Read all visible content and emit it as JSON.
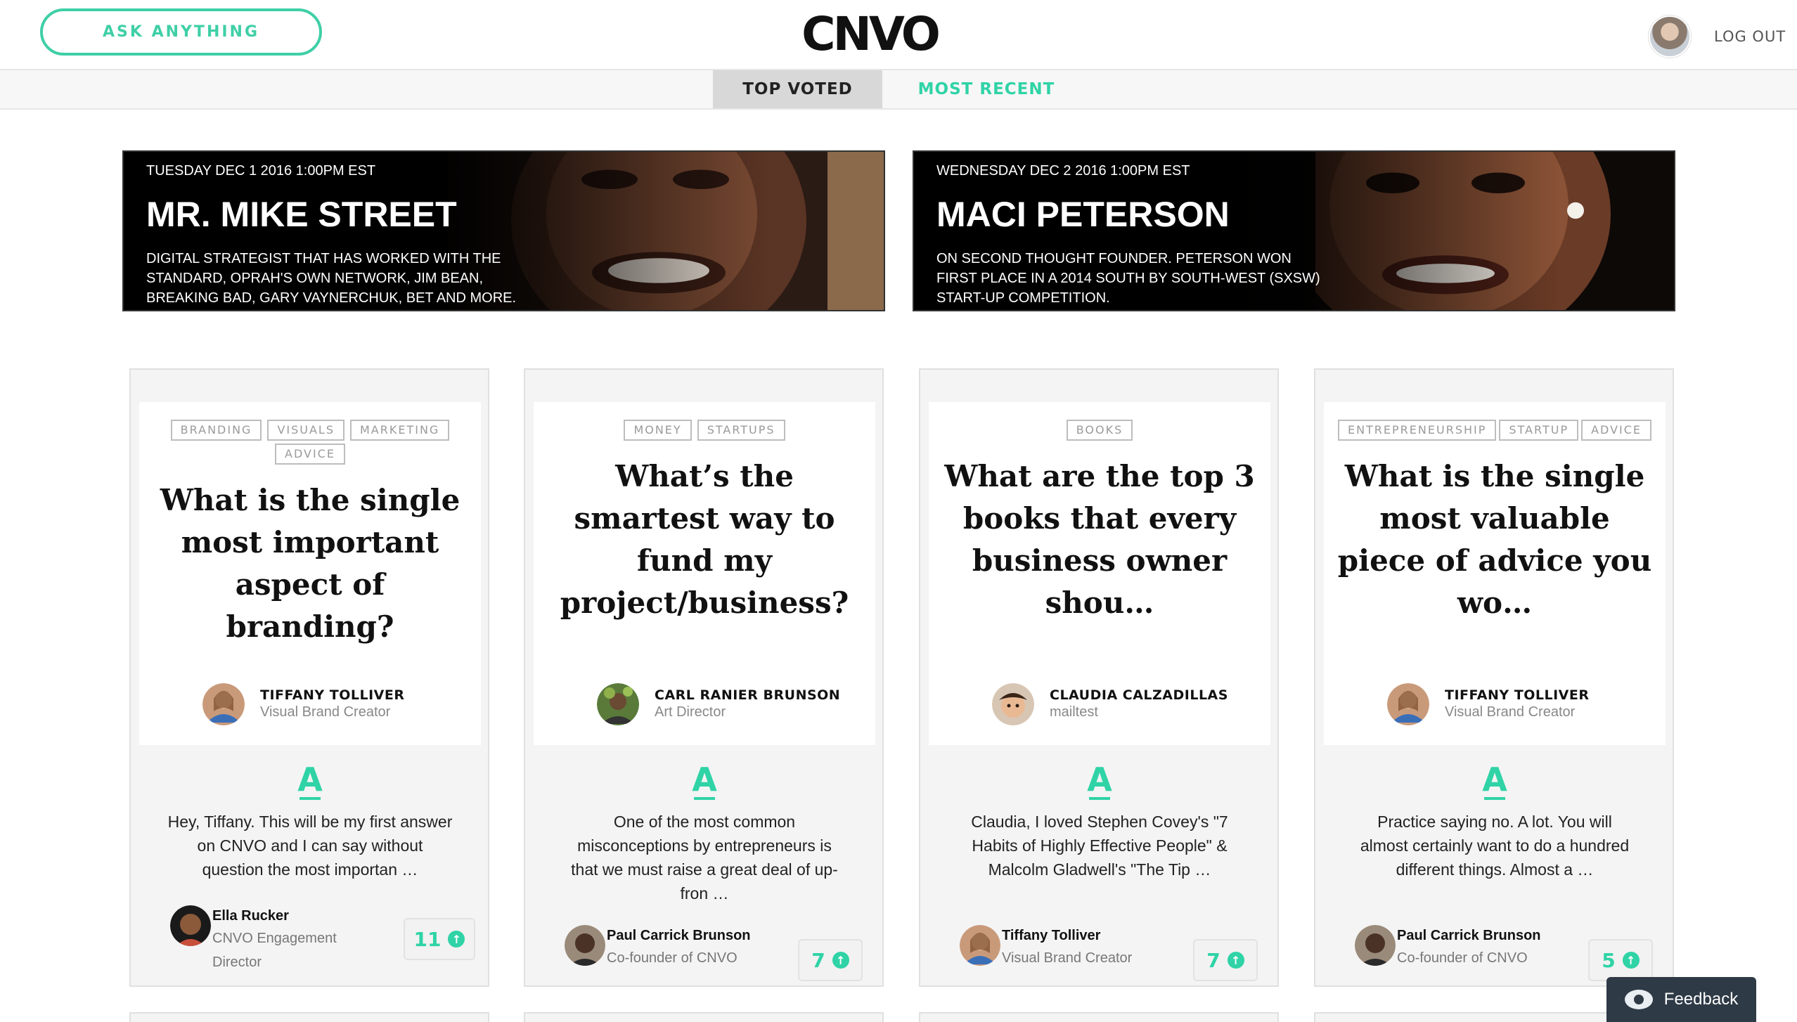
{
  "header": {
    "ask_label": "ASK ANYTHING",
    "logo_text": "CNVO",
    "logout_label": "LOG OUT"
  },
  "tabs": [
    {
      "label": "TOP VOTED",
      "active": true
    },
    {
      "label": "MOST RECENT",
      "active": false
    }
  ],
  "banners": [
    {
      "date": "TUESDAY DEC 1 2016 1:00PM EST",
      "name": "MR. MIKE STREET",
      "description": "DIGITAL STRATEGIST THAT HAS WORKED WITH THE STANDARD, OPRAH'S OWN NETWORK, JIM BEAN, BREAKING BAD, GARY VAYNERCHUK, BET AND MORE."
    },
    {
      "date": "WEDNESDAY DEC 2 2016 1:00PM EST",
      "name": "MACI PETERSON",
      "description": "ON SECOND THOUGHT FOUNDER. PETERSON WON FIRST PLACE IN A 2014 SOUTH BY SOUTH-WEST (SXSW) START-UP COMPETITION."
    }
  ],
  "cards": [
    {
      "tags": [
        "BRANDING",
        "VISUALS",
        "MARKETING",
        "ADVICE"
      ],
      "question": "What is the single most important aspect of branding?",
      "asker": {
        "name": "TIFFANY TOLLIVER",
        "role": "Visual Brand Creator"
      },
      "answer": "Hey, Tiffany. This will be my first answer on CNVO and I can say without question the most importan …",
      "answerer": {
        "name": "Ella Rucker",
        "role": "CNVO Engagement Director"
      },
      "votes": "11"
    },
    {
      "tags": [
        "MONEY",
        "STARTUPS"
      ],
      "question": "What’s the smartest way to fund my project/business?",
      "asker": {
        "name": "CARL RANIER BRUNSON",
        "role": "Art Director"
      },
      "answer": "One of the most common misconceptions by entrepreneurs is that we must raise a great deal of up-fron …",
      "answerer": {
        "name": "Paul Carrick Brunson",
        "role": "Co-founder of CNVO"
      },
      "votes": "7"
    },
    {
      "tags": [
        "BOOKS"
      ],
      "question": "What are the top 3 books that every business owner shou…",
      "asker": {
        "name": "CLAUDIA CALZADILLAS",
        "role": "mailtest"
      },
      "answer": "Claudia, I loved Stephen Covey's \"7 Habits of Highly Effective People\" & Malcolm Gladwell's \"The Tip …",
      "answerer": {
        "name": "Tiffany Tolliver",
        "role": "Visual Brand Creator"
      },
      "votes": "7"
    },
    {
      "tags": [
        "ENTREPRENEURSHIP",
        "STARTUP",
        "ADVICE"
      ],
      "question": "What is the single most valuable piece of advice you wo…",
      "asker": {
        "name": "TIFFANY TOLLIVER",
        "role": "Visual Brand Creator"
      },
      "answer": "Practice saying no. A lot. You will almost certainly want to do a hundred different things. Almost a …",
      "answerer": {
        "name": "Paul Carrick Brunson",
        "role": "Co-founder of CNVO"
      },
      "votes": "5"
    }
  ],
  "feedback": {
    "label": "Feedback"
  },
  "colors": {
    "accent": "#2fd3a6",
    "tab_active_bg": "#d8d8d8",
    "feedback_bg": "#2e3a46"
  }
}
